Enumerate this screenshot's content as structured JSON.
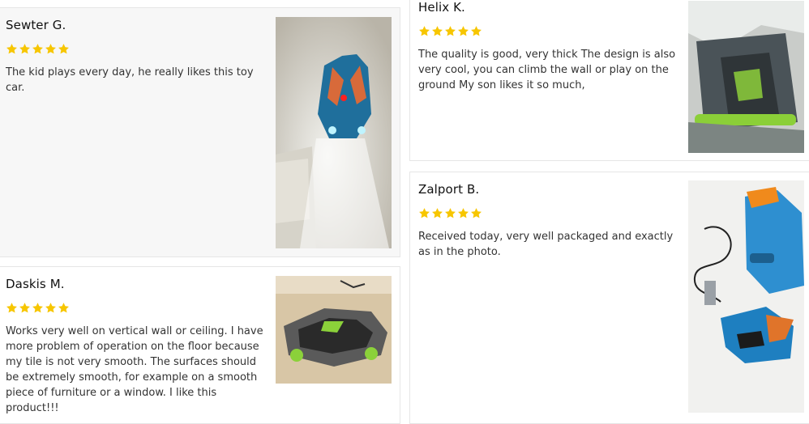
{
  "colors": {
    "star": "#f7c600",
    "card_bg": "#f7f7f7",
    "border": "#e6e6e6"
  },
  "reviews": [
    {
      "name": "Sewter G.",
      "rating": 5,
      "text": "The kid plays every day, he really likes this toy car.",
      "photo": "toy car on wall with headlights"
    },
    {
      "name": "Helix K.",
      "rating": 5,
      "text": "The quality is good, very thick The design is also very cool, you can climb the wall or play on the ground My son likes it so much,",
      "photo": "toy car in plastic packaging"
    },
    {
      "name": "Zalport B.",
      "rating": 5,
      "text": "Received today, very well packaged and exactly as in the photo.",
      "photo": "blue toy car with remote and usb cable"
    },
    {
      "name": "Daskis M.",
      "rating": 5,
      "text": "Works very well on vertical wall or ceiling. I have more problem of operation on the floor because my tile is not very smooth. The surfaces should be extremely smooth, for example on a smooth piece of furniture or a window. I like this product!!!",
      "photo": "green and black toy car"
    }
  ]
}
